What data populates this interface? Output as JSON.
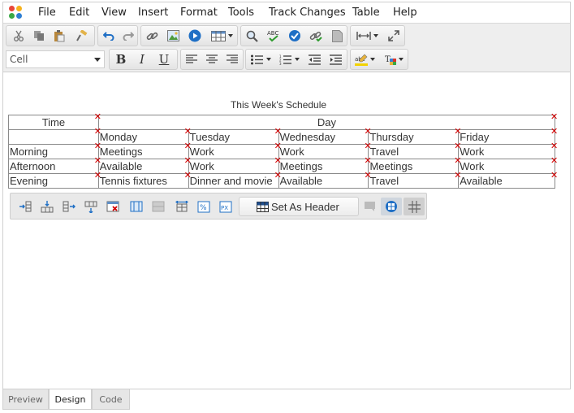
{
  "menu": [
    "File",
    "Edit",
    "View",
    "Insert",
    "Format",
    "Tools",
    "Track Changes",
    "Table",
    "Help"
  ],
  "toolbar": {
    "style_select": "Cell"
  },
  "colors": {
    "delete_marker": "#d40000",
    "accent": "#1f6fc5"
  },
  "table": {
    "caption": "This Week's Schedule",
    "header": {
      "corner": "Time",
      "group": "Day"
    },
    "days": [
      "Monday",
      "Tuesday",
      "Wednesday",
      "Thursday",
      "Friday"
    ],
    "rows": [
      {
        "time": "Morning",
        "cells": [
          "Meetings",
          "Work",
          "Work",
          "Travel",
          "Work"
        ]
      },
      {
        "time": "Afternoon",
        "cells": [
          "Available",
          "Work",
          "Meetings",
          "Meetings",
          "Work"
        ]
      },
      {
        "time": "Evening",
        "cells": [
          "Tennis fixtures",
          "Dinner and movie",
          "Available",
          "Travel",
          "Available"
        ]
      }
    ]
  },
  "table_toolbar": {
    "set_header_label": "Set As Header"
  },
  "tabs": [
    "Preview",
    "Design",
    "Code"
  ],
  "active_tab": "Design"
}
